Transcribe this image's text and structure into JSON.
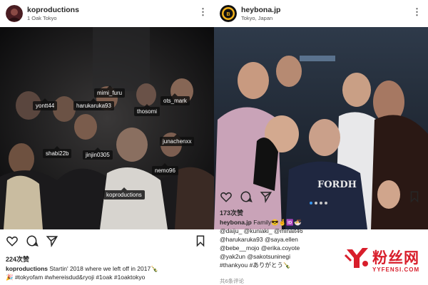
{
  "left_post": {
    "username": "koproductions",
    "location": "1 Oak Tokyo",
    "tags": [
      {
        "label": "mimi_furu"
      },
      {
        "label": "yontt44"
      },
      {
        "label": "harukaruka93"
      },
      {
        "label": "ots_mark"
      },
      {
        "label": "thosomi"
      },
      {
        "label": "shabi22b"
      },
      {
        "label": "jinjin0305"
      },
      {
        "label": "junachenxx"
      },
      {
        "label": "nemo96"
      },
      {
        "label": "koproductions"
      }
    ],
    "likes": "224次赞",
    "caption_user": "koproductions",
    "caption_text": " Startin' 2018 where we left off in 2017🍾",
    "caption_line2": "🎉 #tokyofam #whereisdud&ryoji #1oak #1oaktokyo"
  },
  "right_post": {
    "username": "heybona.jp",
    "location": "Tokyo, Japan",
    "likes": "173次赞",
    "caption_user": "heybona.jp",
    "caption_text": " Family😎🤞🆔🍜",
    "caption_lines": [
      "@daiju_ @kuniaki_ @minait46",
      "@harukaruka93 @saya.ellen",
      "@bebe__mojo @erika.coyote",
      "@yak2un @sakotsuninegi",
      "#thankyou #ありがとう🍾"
    ],
    "comments_count": "共6条评论",
    "shirt_text": "FORDH"
  },
  "watermark": {
    "text": "粉丝网",
    "url": "YYFENSI.COM"
  },
  "icons": [
    "heart-icon",
    "comment-icon",
    "share-icon",
    "bookmark-icon",
    "more-icon",
    "bruins-logo-icon"
  ],
  "colors": {
    "accent_blue": "#3897f0",
    "watermark_red": "#d81e2b"
  }
}
